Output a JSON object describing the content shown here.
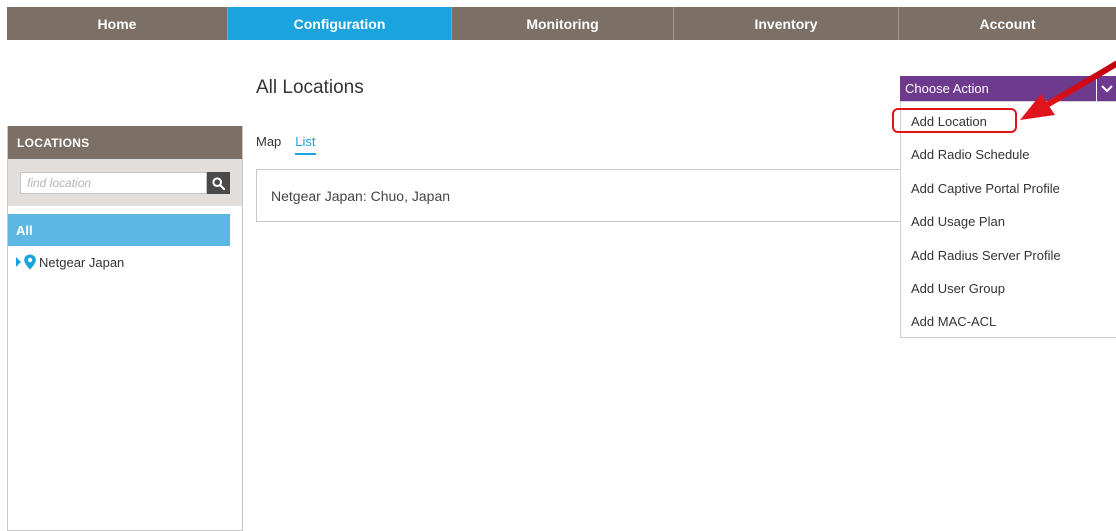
{
  "nav": {
    "home": "Home",
    "configuration": "Configuration",
    "monitoring": "Monitoring",
    "inventory": "Inventory",
    "account": "Account"
  },
  "sidebar": {
    "header": "LOCATIONS",
    "search_placeholder": "find location",
    "all_label": "All",
    "tree": [
      {
        "label": "Netgear Japan"
      }
    ]
  },
  "main": {
    "title": "All Locations",
    "tabs": [
      "Map",
      "List"
    ],
    "active_tab": "List",
    "locations": [
      {
        "label": "Netgear Japan: Chuo, Japan"
      }
    ]
  },
  "action_menu": {
    "label": "Choose Action",
    "items": [
      "Add Location",
      "Add Radio Schedule",
      "Add Captive Portal Profile",
      "Add Usage Plan",
      "Add Radius Server Profile",
      "Add User Group",
      "Add MAC-ACL"
    ],
    "highlighted_item": "Add Location"
  },
  "colors": {
    "nav_bg": "#7b6f66",
    "nav_active": "#1ba3dd",
    "sidebar_selected": "#5cb8e3",
    "action_button": "#6e3a8d",
    "annotation": "#e0141c"
  },
  "icons": {
    "search": "search-icon",
    "location_pin": "map-pin-icon",
    "tree_expand": "triangle-right-icon",
    "dropdown": "chevron-down-icon"
  }
}
